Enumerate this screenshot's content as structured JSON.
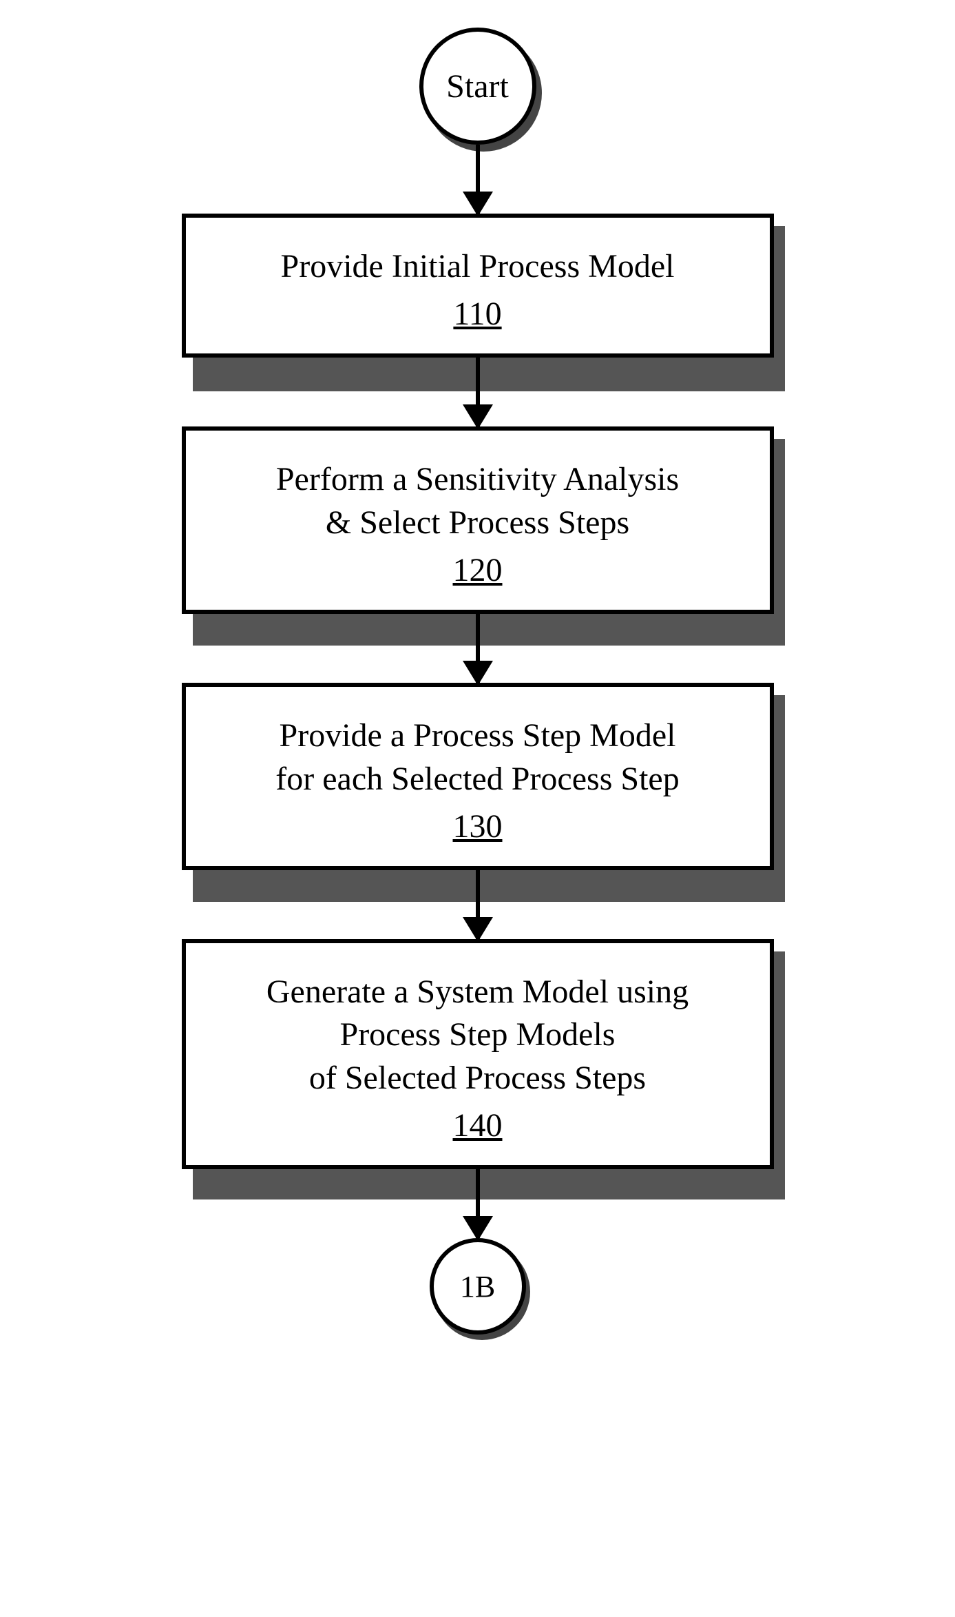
{
  "start": {
    "label": "Start"
  },
  "steps": [
    {
      "text": "Provide Initial Process Model",
      "num": "110"
    },
    {
      "text": "Perform a Sensitivity Analysis\n& Select Process Steps",
      "num": "120"
    },
    {
      "text": "Provide a Process Step Model\nfor each Selected Process Step",
      "num": "130"
    },
    {
      "text": "Generate a System Model using\nProcess Step Models\nof Selected Process Steps",
      "num": "140"
    }
  ],
  "end": {
    "label": "1B"
  }
}
